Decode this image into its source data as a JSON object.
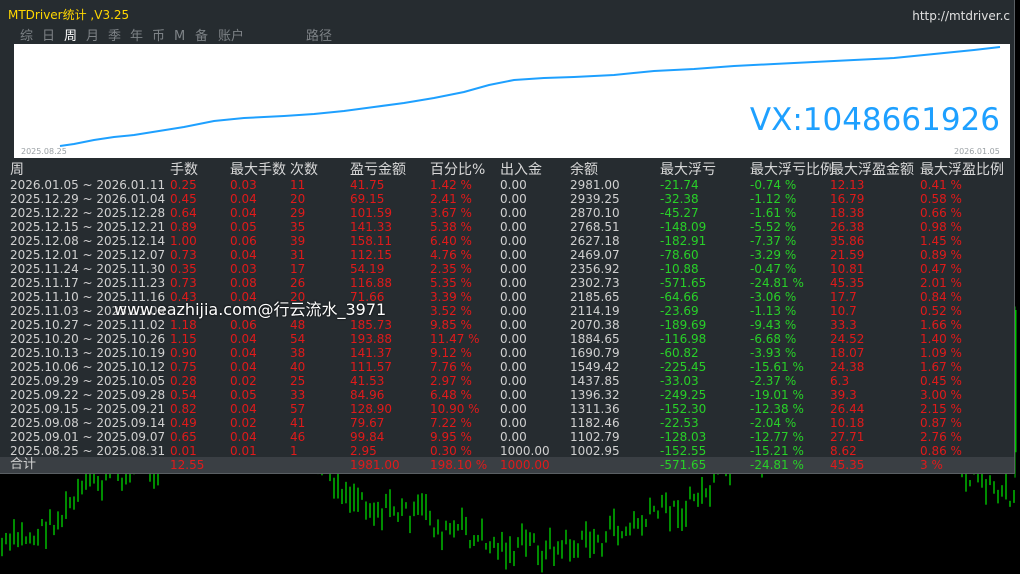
{
  "app_title": "MTDriver统计 ,V3.25",
  "url": "http://mtdriver.c",
  "tabs": [
    "综",
    "日",
    "周",
    "月",
    "季",
    "年",
    "币",
    "M",
    "备",
    "账户",
    "路径"
  ],
  "active_tab": "周",
  "equity_chart": {
    "start_date": "2025.08.25",
    "end_date": "2026.01.05"
  },
  "overlay_text": "VX:1048661926",
  "watermark": "www.eazhijia.com@行云流水_3971",
  "table": {
    "headers": [
      "周",
      "手数",
      "最大手数",
      "次数",
      "盈亏金额",
      "百分比%",
      "出入金",
      "余额",
      "最大浮亏",
      "最大浮亏比例",
      "最大浮盈金额",
      "最大浮盈比例"
    ],
    "rows": [
      [
        "2026.01.05 ~ 2026.01.11",
        "0.25",
        "0.03",
        "11",
        "41.75",
        "1.42 %",
        "0.00",
        "2981.00",
        "-21.74",
        "-0.74 %",
        "12.13",
        "0.41 %"
      ],
      [
        "2025.12.29 ~ 2026.01.04",
        "0.45",
        "0.04",
        "20",
        "69.15",
        "2.41 %",
        "0.00",
        "2939.25",
        "-32.38",
        "-1.12 %",
        "16.79",
        "0.58 %"
      ],
      [
        "2025.12.22 ~ 2025.12.28",
        "0.64",
        "0.04",
        "29",
        "101.59",
        "3.67 %",
        "0.00",
        "2870.10",
        "-45.27",
        "-1.61 %",
        "18.38",
        "0.66 %"
      ],
      [
        "2025.12.15 ~ 2025.12.21",
        "0.89",
        "0.05",
        "35",
        "141.33",
        "5.38 %",
        "0.00",
        "2768.51",
        "-148.09",
        "-5.52 %",
        "26.38",
        "0.98 %"
      ],
      [
        "2025.12.08 ~ 2025.12.14",
        "1.00",
        "0.06",
        "39",
        "158.11",
        "6.40 %",
        "0.00",
        "2627.18",
        "-182.91",
        "-7.37 %",
        "35.86",
        "1.45 %"
      ],
      [
        "2025.12.01 ~ 2025.12.07",
        "0.73",
        "0.04",
        "31",
        "112.15",
        "4.76 %",
        "0.00",
        "2469.07",
        "-78.60",
        "-3.29 %",
        "21.59",
        "0.89 %"
      ],
      [
        "2025.11.24 ~ 2025.11.30",
        "0.35",
        "0.03",
        "17",
        "54.19",
        "2.35 %",
        "0.00",
        "2356.92",
        "-10.88",
        "-0.47 %",
        "10.81",
        "0.47 %"
      ],
      [
        "2025.11.17 ~ 2025.11.23",
        "0.73",
        "0.08",
        "26",
        "116.88",
        "5.35 %",
        "0.00",
        "2302.73",
        "-571.65",
        "-24.81 %",
        "45.35",
        "2.01 %"
      ],
      [
        "2025.11.10 ~ 2025.11.16",
        "0.43",
        "0.04",
        "20",
        "71.66",
        "3.39 %",
        "0.00",
        "2185.65",
        "-64.66",
        "-3.06 %",
        "17.7",
        "0.84 %"
      ],
      [
        "2025.11.03 ~ 2025.11.09",
        "",
        "",
        "",
        "",
        "3.52 %",
        "0.00",
        "2114.19",
        "-23.69",
        "-1.13 %",
        "10.7",
        "0.52 %"
      ],
      [
        "2025.10.27 ~ 2025.11.02",
        "1.18",
        "0.06",
        "48",
        "185.73",
        "9.85 %",
        "0.00",
        "2070.38",
        "-189.69",
        "-9.43 %",
        "33.3",
        "1.66 %"
      ],
      [
        "2025.10.20 ~ 2025.10.26",
        "1.15",
        "0.04",
        "54",
        "193.88",
        "11.47 %",
        "0.00",
        "1884.65",
        "-116.98",
        "-6.68 %",
        "24.52",
        "1.40 %"
      ],
      [
        "2025.10.13 ~ 2025.10.19",
        "0.90",
        "0.04",
        "38",
        "141.37",
        "9.12 %",
        "0.00",
        "1690.79",
        "-60.82",
        "-3.93 %",
        "18.07",
        "1.09 %"
      ],
      [
        "2025.10.06 ~ 2025.10.12",
        "0.75",
        "0.04",
        "40",
        "111.57",
        "7.76 %",
        "0.00",
        "1549.42",
        "-225.45",
        "-15.61 %",
        "24.38",
        "1.67 %"
      ],
      [
        "2025.09.29 ~ 2025.10.05",
        "0.28",
        "0.02",
        "25",
        "41.53",
        "2.97 %",
        "0.00",
        "1437.85",
        "-33.03",
        "-2.37 %",
        "6.3",
        "0.45 %"
      ],
      [
        "2025.09.22 ~ 2025.09.28",
        "0.54",
        "0.05",
        "33",
        "84.96",
        "6.48 %",
        "0.00",
        "1396.32",
        "-249.25",
        "-19.01 %",
        "39.3",
        "3.00 %"
      ],
      [
        "2025.09.15 ~ 2025.09.21",
        "0.82",
        "0.04",
        "57",
        "128.90",
        "10.90 %",
        "0.00",
        "1311.36",
        "-152.30",
        "-12.38 %",
        "26.44",
        "2.15 %"
      ],
      [
        "2025.09.08 ~ 2025.09.14",
        "0.49",
        "0.02",
        "41",
        "79.67",
        "7.22 %",
        "0.00",
        "1182.46",
        "-22.53",
        "-2.04 %",
        "10.18",
        "0.87 %"
      ],
      [
        "2025.09.01 ~ 2025.09.07",
        "0.65",
        "0.04",
        "46",
        "99.84",
        "9.95 %",
        "0.00",
        "1102.79",
        "-128.03",
        "-12.77 %",
        "27.71",
        "2.76 %"
      ],
      [
        "2025.08.25 ~ 2025.08.31",
        "0.01",
        "0.01",
        "1",
        "2.95",
        "0.30 %",
        "1000.00",
        "1002.95",
        "-152.55",
        "-15.21 %",
        "8.62",
        "0.86 %"
      ]
    ],
    "total": {
      "label": "合计",
      "lots": "12.55",
      "pnl": "1981.00",
      "pct": "198.10 %",
      "deposit": "1000.00",
      "max_float_loss": "-571.65",
      "max_float_loss_pct": "-24.81 %",
      "max_float_profit": "45.35",
      "max_float_profit_pct": "3 %"
    }
  },
  "colors": {
    "panel_bg": "#262c30",
    "title_yellow": "#ffd700",
    "equity_line": "#1ea0ff",
    "value_red": "#e01a1a",
    "value_green": "#28d028",
    "value_white": "#d0d0d0",
    "candles": "#00c800"
  }
}
